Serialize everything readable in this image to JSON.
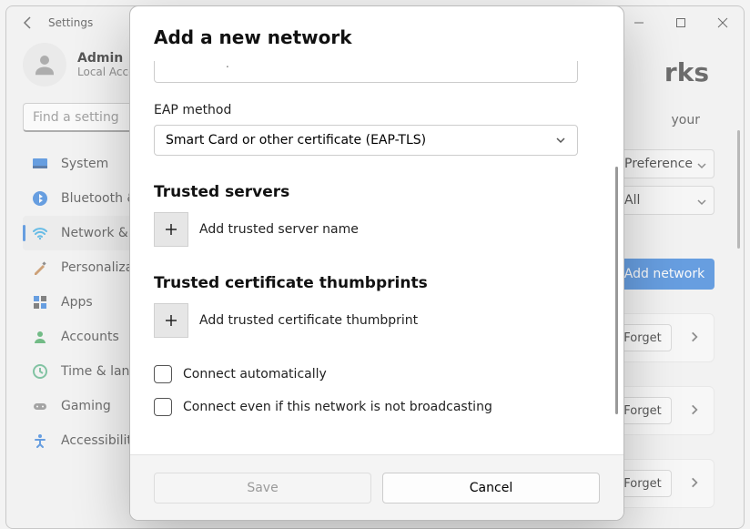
{
  "window": {
    "title": "Settings"
  },
  "profile": {
    "name": "Admin",
    "subtitle": "Local Account"
  },
  "search": {
    "placeholder": "Find a setting"
  },
  "nav": {
    "items": [
      {
        "label": "System"
      },
      {
        "label": "Bluetooth & devices"
      },
      {
        "label": "Network & internet"
      },
      {
        "label": "Personalization"
      },
      {
        "label": "Apps"
      },
      {
        "label": "Accounts"
      },
      {
        "label": "Time & language"
      },
      {
        "label": "Gaming"
      },
      {
        "label": "Accessibility"
      }
    ],
    "active_index": 2
  },
  "page": {
    "title_fragment": "rks",
    "hint_fragment": "your",
    "dropdown1": "Preference",
    "dropdown2": "All",
    "add_network_button": "Add network",
    "card_action": "Forget"
  },
  "dialog": {
    "title": "Add a new network",
    "eap_label": "EAP method",
    "eap_value": "Smart Card or other certificate (EAP-TLS)",
    "trusted_servers_heading": "Trusted servers",
    "add_trusted_server": "Add trusted server name",
    "thumbprints_heading": "Trusted certificate thumbprints",
    "add_thumbprint": "Add trusted certificate thumbprint",
    "connect_auto": "Connect automatically",
    "connect_hidden": "Connect even if this network is not broadcasting",
    "save": "Save",
    "cancel": "Cancel"
  }
}
